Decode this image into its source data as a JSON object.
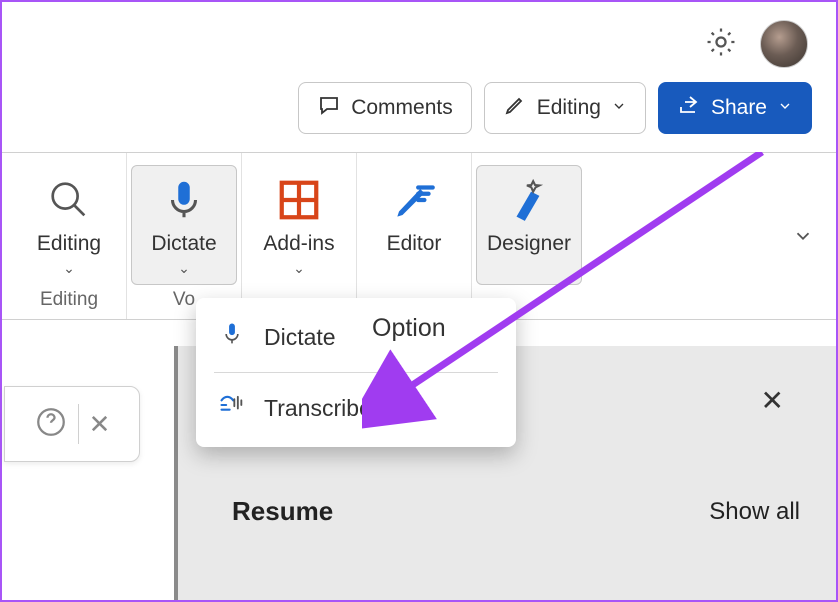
{
  "toolbar": {
    "comments_label": "Comments",
    "editing_label": "Editing",
    "share_label": "Share"
  },
  "ribbon": {
    "editing_group": {
      "btn_label": "Editing",
      "group_label": "Editing"
    },
    "voice_group": {
      "btn_label": "Dictate",
      "group_label": "Vo"
    },
    "addins_label": "Add-ins",
    "editor_label": "Editor",
    "designer_label": "Designer"
  },
  "dropdown": {
    "dictate_label": "Dictate",
    "transcribe_label": "Transcribe",
    "option_label": "Option"
  },
  "panel": {
    "title": "Resume",
    "show_all": "Show all"
  },
  "colors": {
    "accent": "#185abd",
    "arrow": "#a03cf0"
  }
}
